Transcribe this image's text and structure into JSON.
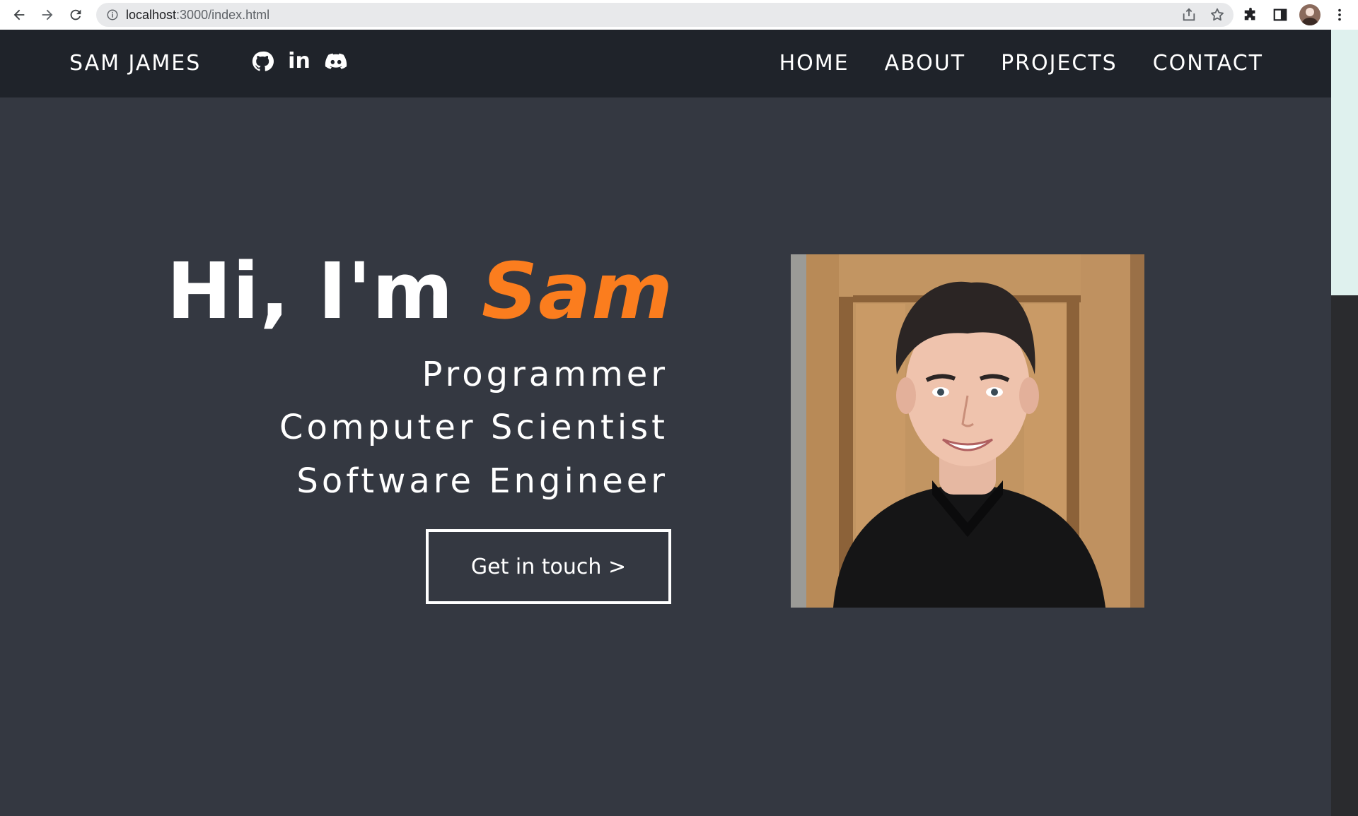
{
  "browser": {
    "url_host": "localhost",
    "url_path": ":3000/index.html"
  },
  "site": {
    "brand": "SAM JAMES",
    "social": [
      {
        "name": "github-icon"
      },
      {
        "name": "linkedin-icon",
        "glyph": "in"
      },
      {
        "name": "discord-icon"
      }
    ],
    "menu": [
      "HOME",
      "ABOUT",
      "PROJECTS",
      "CONTACT"
    ]
  },
  "hero": {
    "greeting": "Hi, I'm ",
    "name": "Sam",
    "roles": [
      "Programmer",
      "Computer Scientist",
      "Software Engineer"
    ],
    "cta_label": "Get in touch >"
  },
  "colors": {
    "accent": "#fb7d1e",
    "nav_bg": "#1f232a",
    "page_bg": "#343841"
  }
}
